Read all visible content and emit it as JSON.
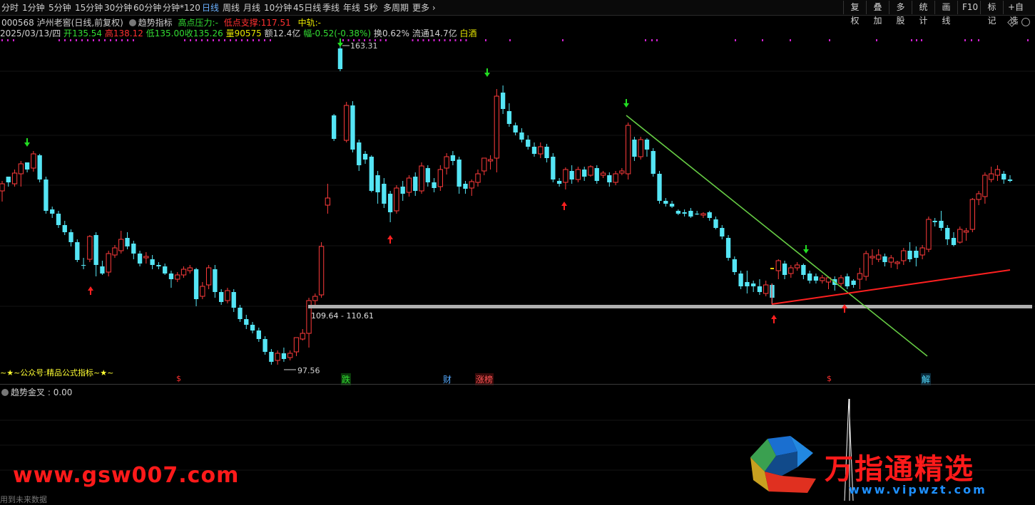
{
  "toolbar": {
    "periods": [
      "分时",
      "1分钟",
      "5分钟",
      "15分钟",
      "30分钟",
      "60分钟",
      "分钟*120",
      "日线",
      "周线",
      "月线",
      "10分钟",
      "45日线",
      "季线",
      "年线",
      "5秒",
      "多周期",
      "更多"
    ],
    "active_period": "日线",
    "right_buttons": [
      "复权",
      "叠加",
      "多股",
      "统计",
      "画线",
      "F10",
      "标记",
      "+自选"
    ]
  },
  "header": {
    "code": "000568",
    "name": "泸州老窖",
    "mode": "(日线,前复权)",
    "indicator": "趋势指标",
    "high_press_label": "高点压力:",
    "high_press_value": "-",
    "low_support_label": "低点支撑:",
    "low_support_value": "117.51",
    "mid_label": "中轨:",
    "mid_value": "-"
  },
  "quote": {
    "date": "2025/03/13/四",
    "open_label": "开",
    "open": "135.54",
    "high_label": "高",
    "high": "138.12",
    "low_label": "低",
    "low": "135.00",
    "close_label": "收",
    "close": "135.26",
    "vol_label": "量",
    "vol": "90575",
    "amt_label": "额",
    "amt": "12.4亿",
    "chg_label": "幅",
    "chg": "-0.52(-0.38%)",
    "turn_label": "换",
    "turn": "0.62%",
    "float_label": "流通",
    "float": "14.7亿",
    "sector": "白酒"
  },
  "annotations": {
    "peak": "163.31",
    "trough": "97.56",
    "range": "109.64 - 110.61",
    "promo": "~★~公众号:精品公式指标~★~"
  },
  "events": [
    {
      "label": "$",
      "color": "#ff3030"
    },
    {
      "label": "跌",
      "color": "#33dd33"
    },
    {
      "label": "财",
      "color": "#55aaff"
    },
    {
      "label": "涨榜",
      "color": "#ff3030"
    },
    {
      "label": "$",
      "color": "#ff3030"
    },
    {
      "label": "解",
      "color": "#55ddff"
    }
  ],
  "sub_panel": {
    "name": "趋势金叉",
    "value": "0.00"
  },
  "watermark": {
    "left_url": "www.gsw007.com",
    "brand": "万指通精选",
    "brand_url": "www.vipwzt.com",
    "bottom_left": "用到未来数据"
  },
  "colors": {
    "up": "#ff3b3b",
    "down": "#55e5f5",
    "support": "#ff2020",
    "resist": "#66cc44",
    "band": "#b0b0b0",
    "dots": "#d020d0"
  },
  "chart_data": {
    "type": "candlestick",
    "candles": [
      [
        268,
        258,
        254,
        283
      ],
      [
        248,
        256,
        252,
        262
      ],
      [
        258,
        243,
        238,
        262
      ],
      [
        244,
        230,
        226,
        262
      ],
      [
        228,
        238,
        234,
        242
      ],
      [
        236,
        216,
        212,
        241
      ],
      [
        218,
        252,
        216,
        256
      ],
      [
        252,
        296,
        248,
        300
      ],
      [
        294,
        300,
        290,
        306
      ],
      [
        300,
        316,
        296,
        320
      ],
      [
        316,
        326,
        310,
        330
      ],
      [
        326,
        340,
        322,
        346
      ],
      [
        340,
        365,
        336,
        368
      ],
      [
        372,
        372,
        362,
        378
      ],
      [
        364,
        332,
        330,
        368
      ],
      [
        330,
        372,
        326,
        388
      ],
      [
        374,
        384,
        366,
        386
      ],
      [
        382,
        356,
        352,
        388
      ],
      [
        358,
        348,
        344,
        362
      ],
      [
        352,
        336,
        324,
        356
      ],
      [
        334,
        346,
        326,
        350
      ],
      [
        342,
        356,
        338,
        364
      ],
      [
        356,
        370,
        352,
        374
      ],
      [
        362,
        360,
        354,
        370
      ],
      [
        364,
        372,
        358,
        378
      ],
      [
        372,
        374,
        368,
        378
      ],
      [
        374,
        384,
        370,
        386
      ],
      [
        384,
        392,
        380,
        404
      ],
      [
        392,
        386,
        382,
        396
      ],
      [
        386,
        378,
        374,
        390
      ],
      [
        380,
        376,
        372,
        384
      ],
      [
        378,
        420,
        376,
        430
      ],
      [
        416,
        402,
        396,
        420
      ],
      [
        400,
        376,
        372,
        406
      ],
      [
        378,
        410,
        372,
        418
      ],
      [
        410,
        424,
        406,
        428
      ],
      [
        422,
        408,
        404,
        426
      ],
      [
        410,
        432,
        406,
        438
      ],
      [
        432,
        448,
        428,
        452
      ],
      [
        448,
        456,
        442,
        462
      ],
      [
        456,
        464,
        452,
        468
      ],
      [
        464,
        476,
        460,
        480
      ],
      [
        476,
        494,
        472,
        498
      ],
      [
        494,
        508,
        490,
        512
      ],
      [
        506,
        496,
        492,
        512
      ],
      [
        496,
        504,
        488,
        508
      ],
      [
        502,
        496,
        492,
        506
      ],
      [
        494,
        474,
        488,
        500
      ],
      [
        476,
        468,
        462,
        478
      ],
      [
        468,
        422,
        418,
        488
      ],
      [
        422,
        416,
        412,
        428
      ],
      [
        414,
        346,
        340,
        418
      ],
      [
        288,
        278,
        258,
        300
      ],
      [
        162,
        195,
        160,
        198
      ],
      [
        68,
        97,
        60,
        100
      ],
      [
        197,
        148,
        143,
        200
      ],
      [
        148,
        210,
        142,
        214
      ],
      [
        200,
        232,
        196,
        240
      ],
      [
        216,
        224,
        212,
        230
      ],
      [
        220,
        268,
        218,
        270
      ],
      [
        246,
        270,
        240,
        286
      ],
      [
        258,
        286,
        250,
        292
      ],
      [
        272,
        298,
        268,
        312
      ],
      [
        296,
        264,
        260,
        300
      ],
      [
        262,
        272,
        254,
        282
      ],
      [
        270,
        250,
        246,
        276
      ],
      [
        248,
        268,
        242,
        275
      ],
      [
        268,
        233,
        228,
        272
      ],
      [
        236,
        256,
        232,
        262
      ],
      [
        256,
        264,
        250,
        270
      ],
      [
        262,
        238,
        232,
        268
      ],
      [
        236,
        220,
        215,
        245
      ],
      [
        218,
        226,
        212,
        232
      ],
      [
        224,
        262,
        220,
        272
      ],
      [
        258,
        265,
        254,
        272
      ],
      [
        264,
        255,
        252,
        275
      ],
      [
        256,
        244,
        238,
        262
      ],
      [
        240,
        222,
        236,
        246
      ],
      [
        226,
        224,
        218,
        238
      ],
      [
        222,
        135,
        125,
        242
      ],
      [
        130,
        153,
        120,
        160
      ],
      [
        156,
        174,
        145,
        178
      ],
      [
        176,
        186,
        172,
        190
      ],
      [
        186,
        196,
        180,
        200
      ],
      [
        196,
        206,
        190,
        210
      ],
      [
        206,
        216,
        200,
        220
      ],
      [
        216,
        206,
        200,
        222
      ],
      [
        206,
        222,
        202,
        228
      ],
      [
        220,
        252,
        215,
        256
      ],
      [
        254,
        258,
        250,
        262
      ],
      [
        256,
        238,
        235,
        266
      ],
      [
        240,
        252,
        232,
        258
      ],
      [
        252,
        238,
        234,
        256
      ],
      [
        238,
        248,
        234,
        254
      ],
      [
        246,
        234,
        232,
        248
      ],
      [
        236,
        254,
        232,
        258
      ],
      [
        246,
        243,
        240,
        250
      ],
      [
        246,
        256,
        242,
        262
      ],
      [
        256,
        244,
        240,
        260
      ],
      [
        243,
        240,
        236,
        246
      ],
      [
        244,
        176,
        172,
        252
      ],
      [
        196,
        220,
        192,
        226
      ],
      [
        220,
        196,
        192,
        224
      ],
      [
        196,
        210,
        194,
        220
      ],
      [
        212,
        244,
        208,
        248
      ],
      [
        244,
        282,
        240,
        286
      ],
      [
        282,
        286,
        278,
        290
      ],
      [
        286,
        290,
        282,
        292
      ],
      [
        296,
        300,
        294,
        302
      ],
      [
        298,
        300,
        294,
        304
      ],
      [
        296,
        304,
        292,
        306
      ],
      [
        300,
        300,
        296,
        302
      ],
      [
        302,
        300,
        298,
        306
      ],
      [
        298,
        306,
        296,
        310
      ],
      [
        308,
        320,
        304,
        322
      ],
      [
        320,
        332,
        316,
        336
      ],
      [
        334,
        362,
        330,
        366
      ],
      [
        364,
        382,
        360,
        386
      ],
      [
        384,
        402,
        380,
        406
      ],
      [
        396,
        402,
        380,
        412
      ],
      [
        398,
        402,
        394,
        410
      ],
      [
        402,
        410,
        392,
        414
      ],
      [
        412,
        400,
        394,
        416
      ],
      [
        400,
        418,
        398,
        428
      ],
      [
        380,
        366,
        364,
        392
      ],
      [
        370,
        386,
        366,
        392
      ],
      [
        384,
        376,
        372,
        390
      ],
      [
        376,
        372,
        368,
        380
      ],
      [
        372,
        386,
        370,
        392
      ],
      [
        384,
        394,
        380,
        398
      ],
      [
        388,
        394,
        384,
        398
      ],
      [
        394,
        390,
        386,
        398
      ],
      [
        396,
        390,
        388,
        406
      ],
      [
        392,
        400,
        388,
        408
      ],
      [
        398,
        390,
        386,
        404
      ],
      [
        388,
        402,
        384,
        406
      ],
      [
        394,
        400,
        392,
        404
      ],
      [
        392,
        384,
        376,
        406
      ],
      [
        388,
        356,
        352,
        394
      ],
      [
        362,
        360,
        350,
        372
      ],
      [
        364,
        358,
        350,
        368
      ],
      [
        360,
        368,
        356,
        374
      ],
      [
        368,
        362,
        358,
        376
      ],
      [
        370,
        368,
        366,
        378
      ],
      [
        366,
        352,
        348,
        372
      ],
      [
        352,
        364,
        340,
        368
      ],
      [
        352,
        362,
        346,
        374
      ],
      [
        358,
        348,
        344,
        364
      ],
      [
        350,
        308,
        304,
        354
      ],
      [
        310,
        312,
        306,
        318
      ],
      [
        310,
        320,
        296,
        324
      ],
      [
        320,
        336,
        316,
        344
      ],
      [
        334,
        344,
        326,
        346
      ],
      [
        340,
        322,
        318,
        342
      ],
      [
        326,
        324,
        320,
        338
      ],
      [
        322,
        280,
        278,
        326
      ],
      [
        280,
        272,
        268,
        288
      ],
      [
        276,
        246,
        242,
        286
      ],
      [
        252,
        244,
        234,
        256
      ],
      [
        246,
        238,
        232,
        254
      ],
      [
        244,
        252,
        240,
        258
      ],
      [
        252,
        254,
        246,
        256
      ]
    ],
    "price_top": 163.31,
    "price_bottom": 97.56,
    "range_band": [
      109.64,
      110.61
    ],
    "low_support": 117.51,
    "sub_indicator": {
      "name": "趋势金叉",
      "value": 0.0
    }
  }
}
